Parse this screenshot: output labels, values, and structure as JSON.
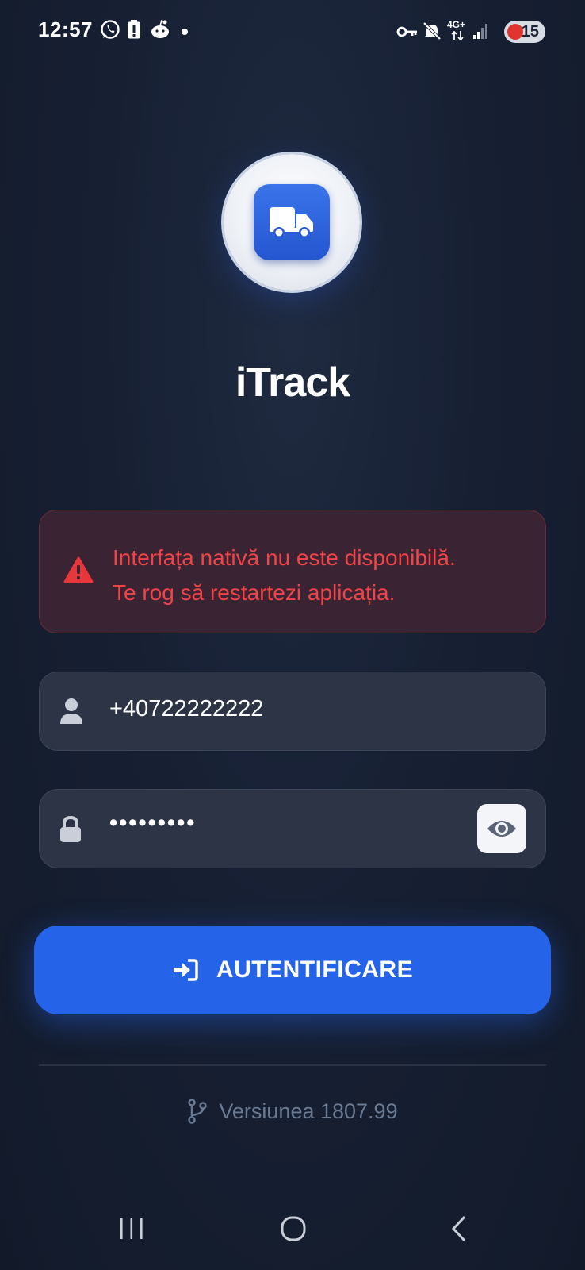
{
  "status_bar": {
    "time": "12:57",
    "network": "4G+",
    "battery_level": "15"
  },
  "app": {
    "title": "iTrack",
    "logo_icon": "truck-icon",
    "accent_color": "#2563e8"
  },
  "error": {
    "icon": "warning-triangle-icon",
    "line1": "Interfața nativă nu este disponibilă.",
    "line2": "Te rog să restartezi aplicația.",
    "color": "#f04447"
  },
  "form": {
    "phone_value": "+40722222222",
    "password_value": "•••••••••"
  },
  "login_button": {
    "label": "AUTENTIFICARE",
    "icon": "sign-in-icon"
  },
  "footer": {
    "version": "Versiunea 1807.99",
    "icon": "code-branch-icon"
  }
}
